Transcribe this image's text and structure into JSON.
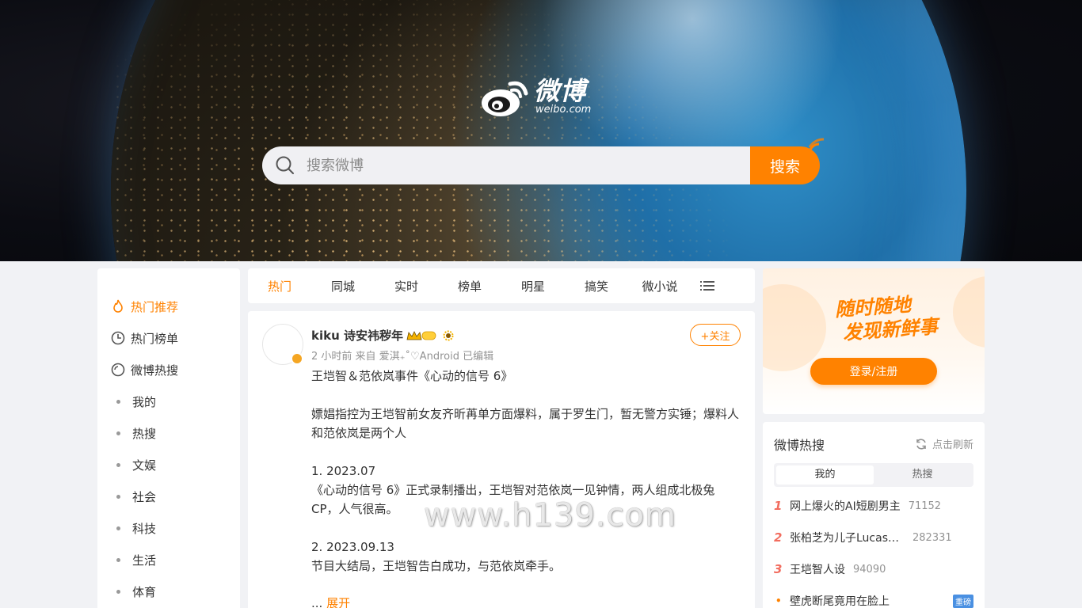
{
  "brand": {
    "name_cn": "微博",
    "name_en": "weibo.com"
  },
  "search": {
    "placeholder": "搜索微博",
    "button_label": "搜索"
  },
  "left_nav": {
    "items": [
      {
        "label": "热门推荐",
        "icon": "fire-icon"
      },
      {
        "label": "热门榜单",
        "icon": "clock-icon"
      },
      {
        "label": "微博热搜",
        "icon": "search-circle-icon"
      },
      {
        "label": "我的"
      },
      {
        "label": "热搜"
      },
      {
        "label": "文娱"
      },
      {
        "label": "社会"
      },
      {
        "label": "科技"
      },
      {
        "label": "生活"
      },
      {
        "label": "体育"
      }
    ]
  },
  "tabs": [
    "热门",
    "同城",
    "实时",
    "榜单",
    "明星",
    "搞笑",
    "微小说"
  ],
  "post": {
    "username": "kiku 诗安祎秽年",
    "meta": "2 小时前  来自 爱淇₊˚♡Android 已编辑",
    "follow_label": "+关注",
    "lines": [
      "王垲智＆范依岚事件《心动的信号 6》",
      "嫖娼指控为王垲智前女友齐昕苒单方面爆料，属于罗生门，暂无警方实锤；爆料人和范依岚是两个人",
      "1. 2023.07",
      "《心动的信号 6》正式录制播出，王垲智对范依岚一见钟情，两人组成北极兔 CP，人气很高。",
      "2. 2023.09.13",
      "节目大结局，王垲智告白成功，与范依岚牵手。"
    ],
    "expand_prefix": "... ",
    "expand_label": "展开"
  },
  "watermark": "www.h139.com",
  "login_card": {
    "slogan_line1": "随时随地",
    "slogan_line2": "发现新鲜事",
    "button_label": "登录/注册"
  },
  "hot_search": {
    "title": "微博热搜",
    "refresh_label": "点击刷新",
    "segments": [
      "我的",
      "热搜"
    ],
    "items": [
      {
        "rank": "1",
        "text": "网上爆火的AI短剧男主",
        "count": "71152"
      },
      {
        "rank": "2",
        "text": "张柏芝为儿子Lucas庆生",
        "count": "282331"
      },
      {
        "rank": "3",
        "text": "王垲智人设",
        "count": "94090"
      },
      {
        "rank": "•",
        "text": "壁虎断尾竟用在脸上",
        "count": "",
        "badge": "重磅"
      }
    ]
  },
  "colors": {
    "accent": "#ff8200",
    "rank": "#f26d5f",
    "badge": "#4a90e2"
  }
}
